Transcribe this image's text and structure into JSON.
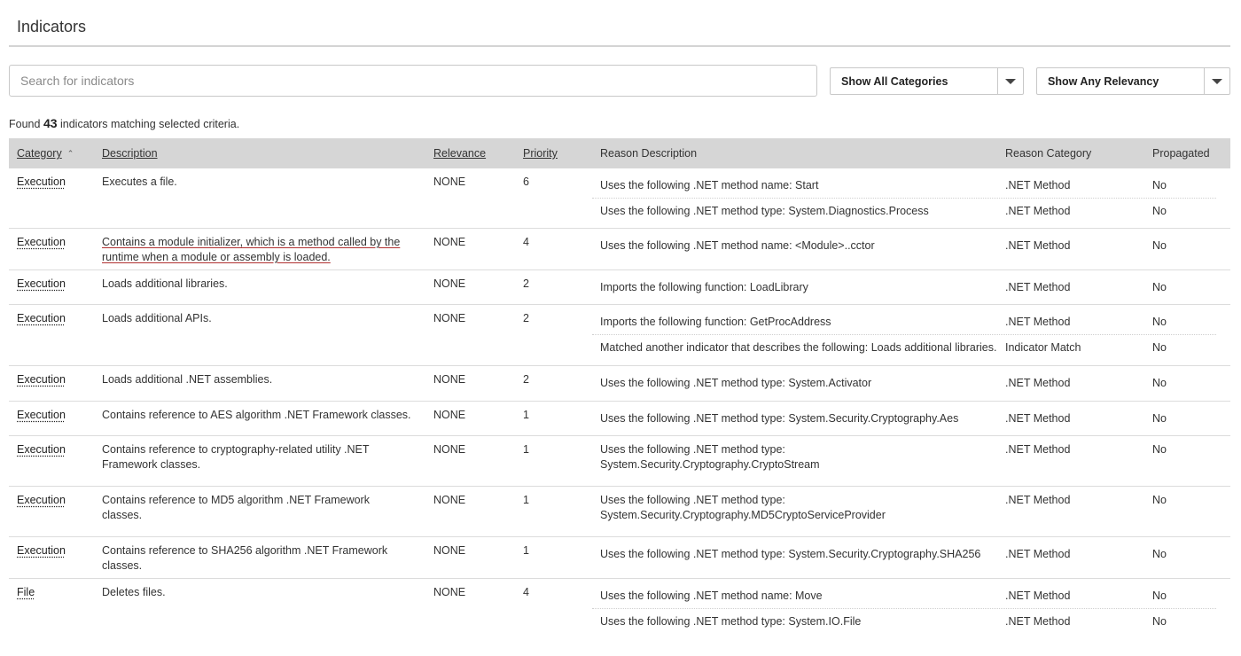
{
  "page": {
    "title": "Indicators"
  },
  "search": {
    "placeholder": "Search for indicators",
    "value": ""
  },
  "filters": {
    "category": "Show All Categories",
    "relevancy": "Show Any Relevancy"
  },
  "summary": {
    "prefix": "Found",
    "count": "43",
    "suffix": "indicators matching selected criteria."
  },
  "table": {
    "headers": {
      "category": "Category",
      "description": "Description",
      "relevance": "Relevance",
      "priority": "Priority",
      "reason_description": "Reason Description",
      "reason_category": "Reason Category",
      "propagated": "Propagated"
    },
    "rows": [
      {
        "category": "Execution",
        "description": "Executes a file.",
        "relevance": "NONE",
        "priority": "6",
        "reasons": [
          {
            "description": "Uses the following .NET method name: Start",
            "category": ".NET Method",
            "propagated": "No"
          },
          {
            "description": "Uses the following .NET method type: System.Diagnostics.Process",
            "category": ".NET Method",
            "propagated": "No"
          }
        ]
      },
      {
        "category": "Execution",
        "description": "Contains a module initializer, which is a method called by the runtime when a module or assembly is loaded.",
        "relevance": "NONE",
        "priority": "4",
        "reasons": [
          {
            "description": "Uses the following .NET method name: <Module>..cctor",
            "category": ".NET Method",
            "propagated": "No"
          }
        ]
      },
      {
        "category": "Execution",
        "description": "Loads additional libraries.",
        "relevance": "NONE",
        "priority": "2",
        "reasons": [
          {
            "description": "Imports the following function: LoadLibrary",
            "category": ".NET Method",
            "propagated": "No"
          }
        ]
      },
      {
        "category": "Execution",
        "description": "Loads additional APIs.",
        "relevance": "NONE",
        "priority": "2",
        "reasons": [
          {
            "description": "Imports the following function: GetProcAddress",
            "category": ".NET Method",
            "propagated": "No"
          },
          {
            "description": "Matched another indicator that describes the following: Loads additional libraries.",
            "category": "Indicator Match",
            "propagated": "No"
          }
        ]
      },
      {
        "category": "Execution",
        "description": "Loads additional .NET assemblies.",
        "relevance": "NONE",
        "priority": "2",
        "reasons": [
          {
            "description": "Uses the following .NET method type: System.Activator",
            "category": ".NET Method",
            "propagated": "No"
          }
        ]
      },
      {
        "category": "Execution",
        "description": "Contains reference to AES algorithm .NET Framework classes.",
        "relevance": "NONE",
        "priority": "1",
        "reasons": [
          {
            "description": "Uses the following .NET method type: System.Security.Cryptography.Aes",
            "category": ".NET Method",
            "propagated": "No"
          }
        ]
      },
      {
        "category": "Execution",
        "description": "Contains reference to cryptography-related utility .NET Framework classes.",
        "relevance": "NONE",
        "priority": "1",
        "reasons": [
          {
            "description": "Uses the following .NET method type: System.Security.Cryptography.CryptoStream",
            "category": ".NET Method",
            "propagated": "No"
          }
        ]
      },
      {
        "category": "Execution",
        "description": "Contains reference to MD5 algorithm .NET Framework classes.",
        "relevance": "NONE",
        "priority": "1",
        "reasons": [
          {
            "description": "Uses the following .NET method type: System.Security.Cryptography.MD5CryptoServiceProvider",
            "category": ".NET Method",
            "propagated": "No"
          }
        ]
      },
      {
        "category": "Execution",
        "description": "Contains reference to SHA256 algorithm .NET Framework classes.",
        "relevance": "NONE",
        "priority": "1",
        "reasons": [
          {
            "description": "Uses the following .NET method type: System.Security.Cryptography.SHA256",
            "category": ".NET Method",
            "propagated": "No"
          }
        ]
      },
      {
        "category": "File",
        "description": "Deletes files.",
        "relevance": "NONE",
        "priority": "4",
        "reasons": [
          {
            "description": "Uses the following .NET method name: Move",
            "category": ".NET Method",
            "propagated": "No"
          },
          {
            "description": "Uses the following .NET method type: System.IO.File",
            "category": ".NET Method",
            "propagated": "No"
          }
        ]
      }
    ]
  }
}
